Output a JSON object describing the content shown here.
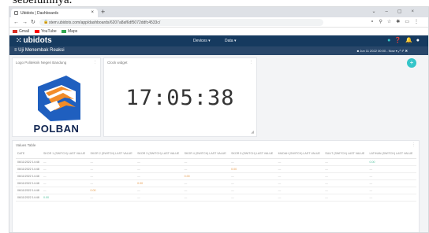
{
  "caption": "sebelumnya.",
  "browser": {
    "tab_title": "Ubidots | Dashboards",
    "tab_close": "×",
    "new_tab": "+",
    "url": "stem.ubidots.com/app/dashboards/6207a8af6df5072ddfc4533c/",
    "bookmarks": [
      {
        "label": "Gmail",
        "color": "#d93025"
      },
      {
        "label": "YouTube",
        "color": "#ff0000"
      },
      {
        "label": "Maps",
        "color": "#34a853"
      }
    ]
  },
  "app": {
    "brand": "ubidots",
    "menu": {
      "devices": "Devices ▾",
      "data": "Data ▾"
    },
    "dashboard_title": "≡ Uji Menembak Reaksi",
    "date_range": "■ Jun 11 2022 00:00 - Now ▾   ⤢  ✐  ✖",
    "colors": {
      "nav": "#163a5f",
      "bar": "#29476a",
      "accent": "#35c5c9"
    }
  },
  "widgets": {
    "logo": {
      "title": "Logo Politeknik Negeri Bandung",
      "text": "POLBAN"
    },
    "clock": {
      "title": "Clock widget",
      "time": "17:05:38"
    },
    "table": {
      "title": "Values Table",
      "columns": [
        "DATE",
        "SKOR 1 (SWITCH) LAST VALUE",
        "SKOR 2 (SWITCH) LAST VALUE",
        "SKOR 3 (SWITCH) LAST VALUE",
        "SKOR 4 (SWITCH) LAST VALUE",
        "SKOR 5 (SWITCH) LAST VALUE",
        "MUDAH (SWITCH) LAST VALUE",
        "SULIT (SWITCH) LAST VALUE",
        "LATIHAN (SWITCH) LAST VALUE"
      ],
      "rows": [
        [
          "06/11/2022 14:48",
          "—",
          "—",
          "—",
          "—",
          "—",
          "—",
          "—",
          "0.00"
        ],
        [
          "06/11/2022 14:48",
          "—",
          "—",
          "—",
          "—",
          "0.00",
          "—",
          "—",
          "—"
        ],
        [
          "06/11/2022 14:48",
          "—",
          "—",
          "—",
          "0.00",
          "—",
          "—",
          "—",
          "—"
        ],
        [
          "06/11/2022 14:48",
          "—",
          "—",
          "0.00",
          "—",
          "—",
          "—",
          "—",
          "—"
        ],
        [
          "06/11/2022 14:48",
          "—",
          "0.00",
          "—",
          "—",
          "—",
          "—",
          "—",
          "—"
        ],
        [
          "06/11/2022 14:48",
          "0.00",
          "—",
          "—",
          "—",
          "—",
          "—",
          "—",
          "—"
        ]
      ]
    }
  }
}
